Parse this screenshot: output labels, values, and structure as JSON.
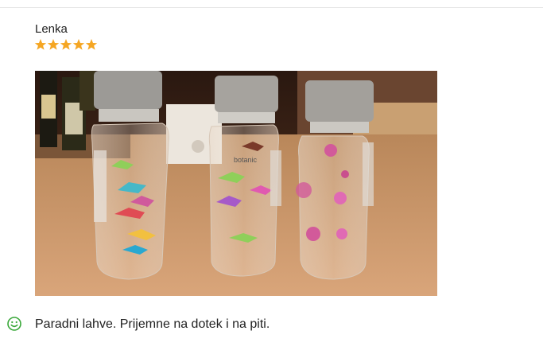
{
  "review": {
    "author": "Lenka",
    "rating": 5,
    "rating_max": 5,
    "text": "Paradni lahve. Prijemne na dotek i na piti.",
    "sentiment_icon": "smiley-positive-icon",
    "star_color": "#f5a623",
    "sentiment_color": "#3aa83a"
  },
  "photo": {
    "label_text": "botanic"
  }
}
